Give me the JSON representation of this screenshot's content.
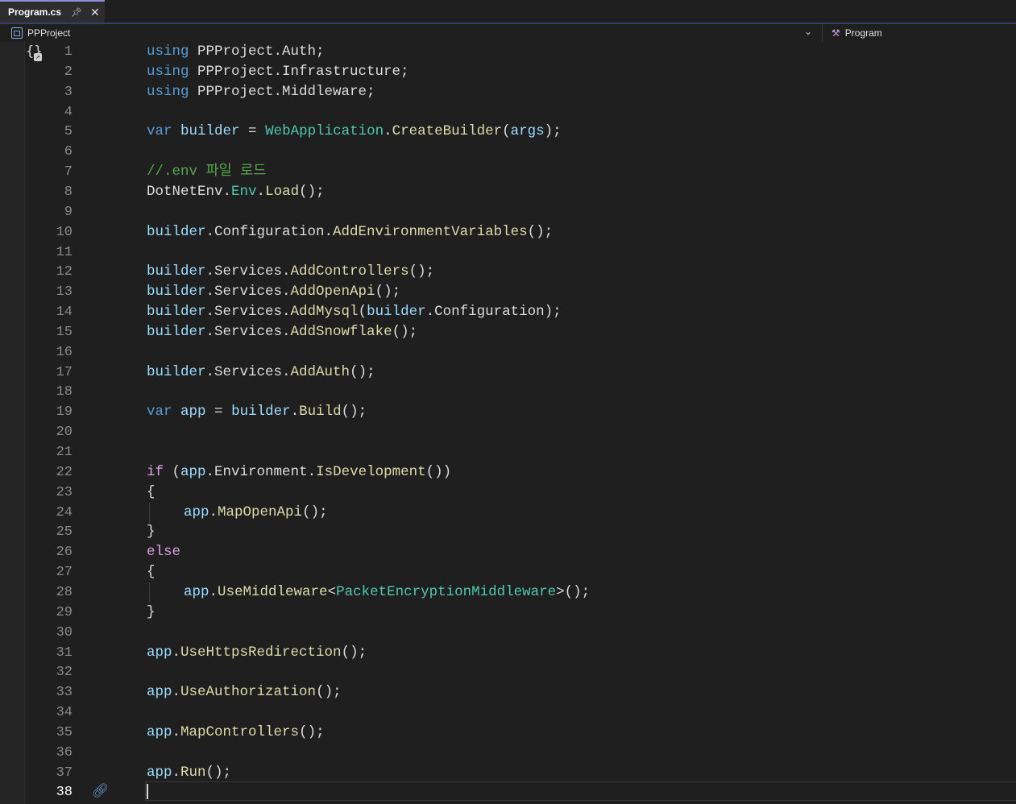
{
  "tab": {
    "title": "Program.cs",
    "pin_icon": "pin-icon",
    "close_icon": "close-icon"
  },
  "nav": {
    "project": "PPProject",
    "member": "Program"
  },
  "lines": [
    {
      "n": "1",
      "t": [
        [
          "kw",
          "using"
        ],
        [
          "pl",
          " PPProject.Auth;"
        ]
      ]
    },
    {
      "n": "2",
      "t": [
        [
          "kw",
          "using"
        ],
        [
          "pl",
          " PPProject.Infrastructure;"
        ]
      ]
    },
    {
      "n": "3",
      "t": [
        [
          "kw",
          "using"
        ],
        [
          "pl",
          " PPProject.Middleware;"
        ]
      ]
    },
    {
      "n": "4",
      "t": []
    },
    {
      "n": "5",
      "t": [
        [
          "kw",
          "var"
        ],
        [
          "pl",
          " "
        ],
        [
          "id",
          "builder"
        ],
        [
          "pl",
          " = "
        ],
        [
          "ty",
          "WebApplication"
        ],
        [
          "pl",
          "."
        ],
        [
          "fn",
          "CreateBuilder"
        ],
        [
          "pl",
          "("
        ],
        [
          "id",
          "args"
        ],
        [
          "pl",
          ");"
        ]
      ]
    },
    {
      "n": "6",
      "t": []
    },
    {
      "n": "7",
      "t": [
        [
          "cm",
          "//.env 파일 로드"
        ]
      ]
    },
    {
      "n": "8",
      "t": [
        [
          "pl",
          "DotNetEnv."
        ],
        [
          "ty",
          "Env"
        ],
        [
          "pl",
          "."
        ],
        [
          "fn",
          "Load"
        ],
        [
          "pl",
          "();"
        ]
      ]
    },
    {
      "n": "9",
      "t": []
    },
    {
      "n": "10",
      "t": [
        [
          "id",
          "builder"
        ],
        [
          "pl",
          ".Configuration."
        ],
        [
          "fn",
          "AddEnvironmentVariables"
        ],
        [
          "pl",
          "();"
        ]
      ]
    },
    {
      "n": "11",
      "t": []
    },
    {
      "n": "12",
      "t": [
        [
          "id",
          "builder"
        ],
        [
          "pl",
          ".Services."
        ],
        [
          "fn",
          "AddControllers"
        ],
        [
          "pl",
          "();"
        ]
      ]
    },
    {
      "n": "13",
      "t": [
        [
          "id",
          "builder"
        ],
        [
          "pl",
          ".Services."
        ],
        [
          "fn",
          "AddOpenApi"
        ],
        [
          "pl",
          "();"
        ]
      ]
    },
    {
      "n": "14",
      "t": [
        [
          "id",
          "builder"
        ],
        [
          "pl",
          ".Services."
        ],
        [
          "fn",
          "AddMysql"
        ],
        [
          "pl",
          "("
        ],
        [
          "id",
          "builder"
        ],
        [
          "pl",
          ".Configuration);"
        ]
      ]
    },
    {
      "n": "15",
      "t": [
        [
          "id",
          "builder"
        ],
        [
          "pl",
          ".Services."
        ],
        [
          "fn",
          "AddSnowflake"
        ],
        [
          "pl",
          "();"
        ]
      ]
    },
    {
      "n": "16",
      "t": []
    },
    {
      "n": "17",
      "t": [
        [
          "id",
          "builder"
        ],
        [
          "pl",
          ".Services."
        ],
        [
          "fn",
          "AddAuth"
        ],
        [
          "pl",
          "();"
        ]
      ]
    },
    {
      "n": "18",
      "t": []
    },
    {
      "n": "19",
      "t": [
        [
          "kw",
          "var"
        ],
        [
          "pl",
          " "
        ],
        [
          "id",
          "app"
        ],
        [
          "pl",
          " = "
        ],
        [
          "id",
          "builder"
        ],
        [
          "pl",
          "."
        ],
        [
          "fn",
          "Build"
        ],
        [
          "pl",
          "();"
        ]
      ]
    },
    {
      "n": "20",
      "t": []
    },
    {
      "n": "21",
      "t": []
    },
    {
      "n": "22",
      "t": [
        [
          "ctl",
          "if"
        ],
        [
          "pl",
          " ("
        ],
        [
          "id",
          "app"
        ],
        [
          "pl",
          ".Environment."
        ],
        [
          "fn",
          "IsDevelopment"
        ],
        [
          "pl",
          "())"
        ]
      ]
    },
    {
      "n": "23",
      "t": [
        [
          "pl",
          "{"
        ]
      ]
    },
    {
      "n": "24",
      "indent": true,
      "t": [
        [
          "id",
          "app"
        ],
        [
          "pl",
          "."
        ],
        [
          "fn",
          "MapOpenApi"
        ],
        [
          "pl",
          "();"
        ]
      ]
    },
    {
      "n": "25",
      "t": [
        [
          "pl",
          "}"
        ]
      ]
    },
    {
      "n": "26",
      "t": [
        [
          "ctl",
          "else"
        ]
      ]
    },
    {
      "n": "27",
      "t": [
        [
          "pl",
          "{"
        ]
      ]
    },
    {
      "n": "28",
      "indent": true,
      "t": [
        [
          "id",
          "app"
        ],
        [
          "pl",
          "."
        ],
        [
          "fn",
          "UseMiddleware"
        ],
        [
          "pl",
          "<"
        ],
        [
          "ty",
          "PacketEncryptionMiddleware"
        ],
        [
          "pl",
          ">();"
        ]
      ]
    },
    {
      "n": "29",
      "t": [
        [
          "pl",
          "}"
        ]
      ]
    },
    {
      "n": "30",
      "t": []
    },
    {
      "n": "31",
      "t": [
        [
          "id",
          "app"
        ],
        [
          "pl",
          "."
        ],
        [
          "fn",
          "UseHttpsRedirection"
        ],
        [
          "pl",
          "();"
        ]
      ]
    },
    {
      "n": "32",
      "t": []
    },
    {
      "n": "33",
      "t": [
        [
          "id",
          "app"
        ],
        [
          "pl",
          "."
        ],
        [
          "fn",
          "UseAuthorization"
        ],
        [
          "pl",
          "();"
        ]
      ]
    },
    {
      "n": "34",
      "t": []
    },
    {
      "n": "35",
      "t": [
        [
          "id",
          "app"
        ],
        [
          "pl",
          "."
        ],
        [
          "fn",
          "MapControllers"
        ],
        [
          "pl",
          "();"
        ]
      ]
    },
    {
      "n": "36",
      "t": []
    },
    {
      "n": "37",
      "t": [
        [
          "id",
          "app"
        ],
        [
          "pl",
          "."
        ],
        [
          "fn",
          "Run"
        ],
        [
          "pl",
          "();"
        ]
      ]
    },
    {
      "n": "38",
      "current": true,
      "t": []
    }
  ]
}
